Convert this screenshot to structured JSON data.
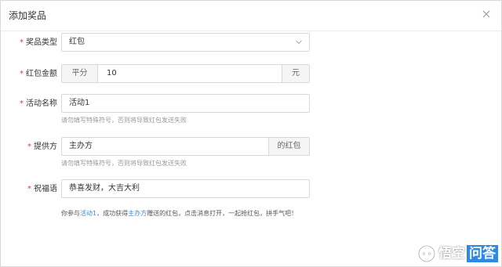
{
  "dialog": {
    "title": "添加奖品",
    "close_icon": "close-icon"
  },
  "form": {
    "prize_type": {
      "label": "奖品类型",
      "value": "红包",
      "required": "*"
    },
    "amount": {
      "label": "红包金额",
      "prefix": "平分",
      "value": "10",
      "suffix": "元",
      "required": "*"
    },
    "activity_name": {
      "label": "活动名称",
      "value": "活动1",
      "hint": "请勿填写特殊符号，否则将导致红包发送失败",
      "required": "*"
    },
    "provider": {
      "label": "提供方",
      "value": "主办方",
      "suffix": "的红包",
      "hint": "请勿填写特殊符号，否则将导致红包发送失败",
      "required": "*"
    },
    "blessing": {
      "label": "祝福语",
      "value": "恭喜发财，大吉大利",
      "required": "*"
    }
  },
  "preview": {
    "part1": "你参与",
    "activity": "活动1",
    "part2": "，成功获得",
    "provider": "主办方",
    "part3": "赠送的红包，点击消息打开，一起抢红包，拼手气吧！"
  },
  "watermark": {
    "text1": "悟空",
    "text2": "问答"
  },
  "colors": {
    "required": "#e4393c",
    "highlight": "#3a88d6",
    "border": "#d9d9d9",
    "addon_bg": "#f5f5f5",
    "watermark_blue": "#2a8ae8"
  }
}
